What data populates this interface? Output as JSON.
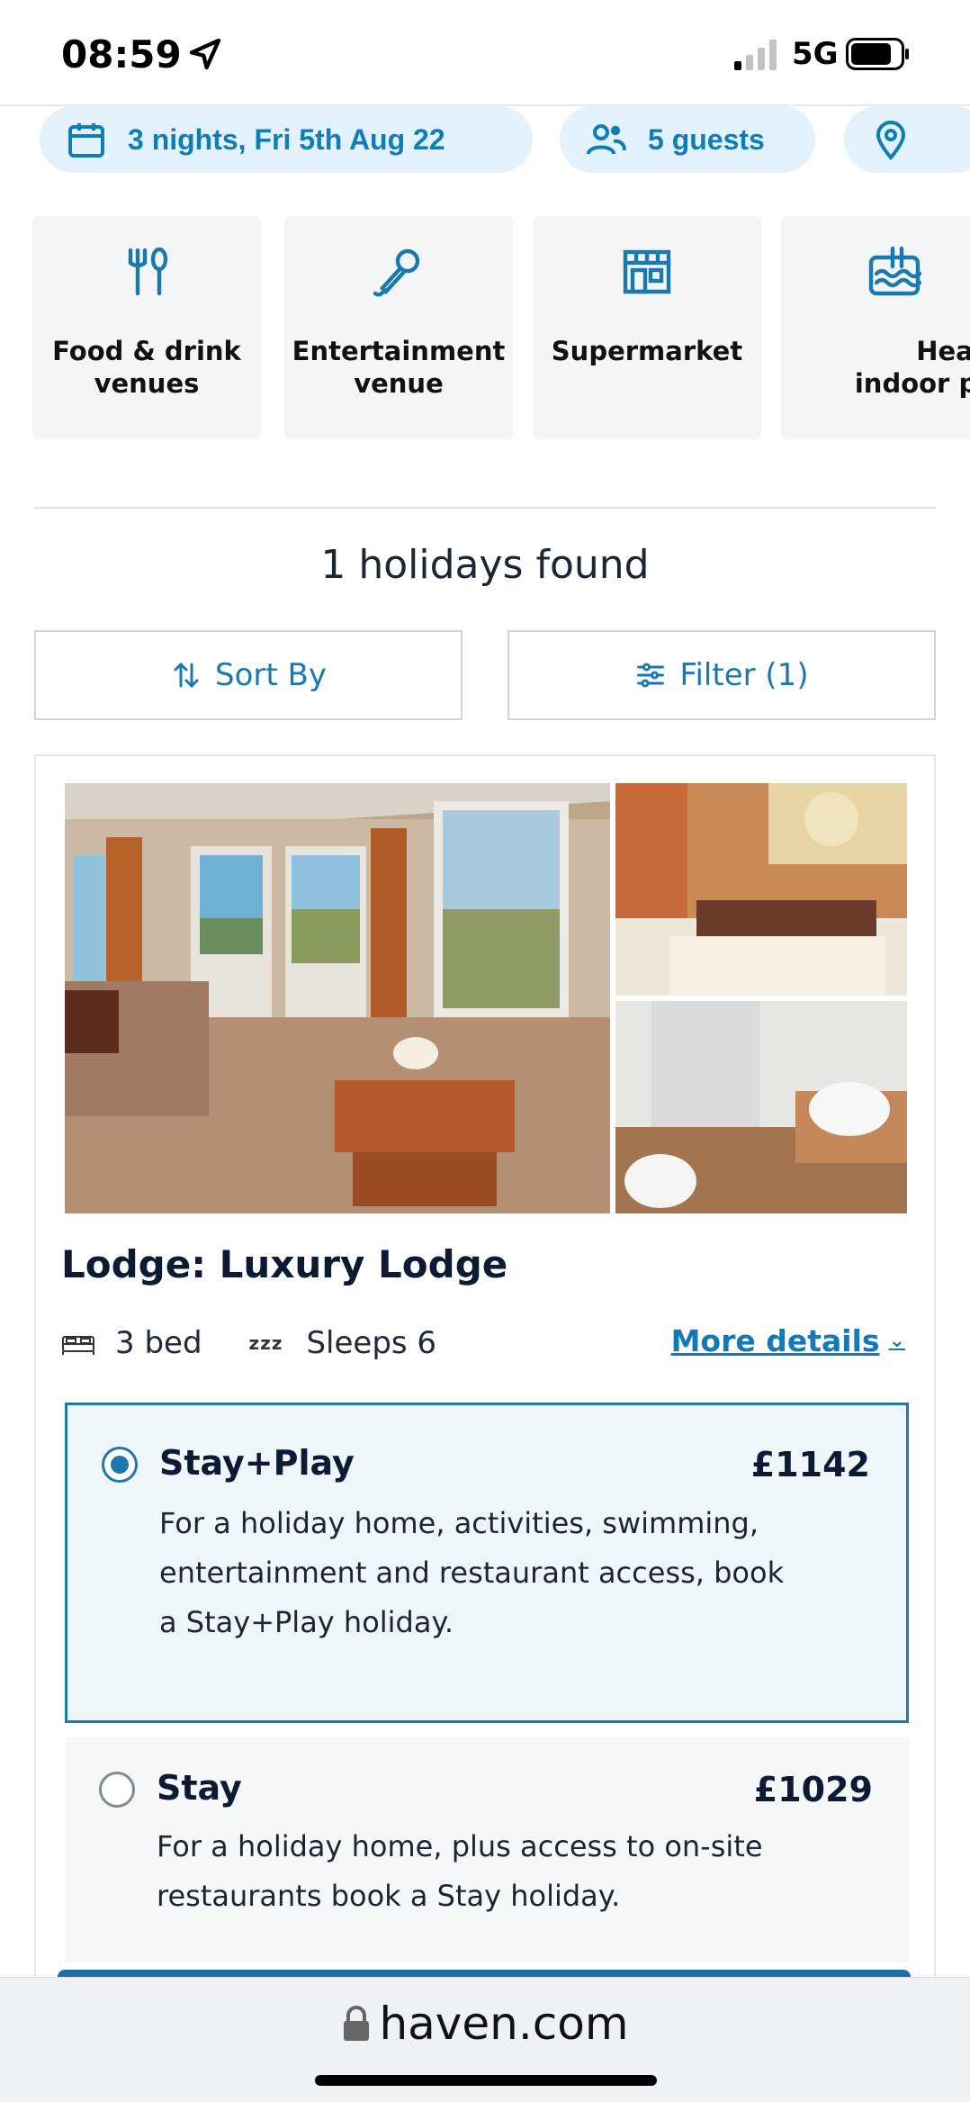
{
  "status_bar": {
    "time": "08:59",
    "network": "5G"
  },
  "search": {
    "dates": "3 nights, Fri 5th Aug 22",
    "guests": "5 guests"
  },
  "amenities": [
    {
      "label": "Food & drink\nvenues",
      "icon": "cutlery-icon"
    },
    {
      "label": "Entertainment\nvenue",
      "icon": "microphone-icon"
    },
    {
      "label": "Supermarket",
      "icon": "shop-icon"
    },
    {
      "label": "Heated\nindoor pool",
      "icon": "pool-icon"
    }
  ],
  "results": {
    "count_text": "1 holidays found",
    "sort_label": "Sort By",
    "filter_label": "Filter (1)"
  },
  "listing": {
    "title": "Lodge: Luxury Lodge",
    "beds": "3 bed",
    "sleeps": "Sleeps 6",
    "sleeps_icon_text": "zzz",
    "more_details": "More details",
    "options": [
      {
        "name": "Stay+Play",
        "price": "£1142",
        "description": "For a holiday home, activities, swimming, entertainment and restaurant access, book a Stay+Play holiday.",
        "selected": true
      },
      {
        "name": "Stay",
        "price": "£1029",
        "description": "For a holiday home, plus access to on-site restaurants book a Stay holiday.",
        "selected": false
      }
    ]
  },
  "browser": {
    "url": "haven.com"
  },
  "colors": {
    "accent": "#1c78ad",
    "pill_bg": "#e2f1fb",
    "navy": "#0c1b33"
  }
}
